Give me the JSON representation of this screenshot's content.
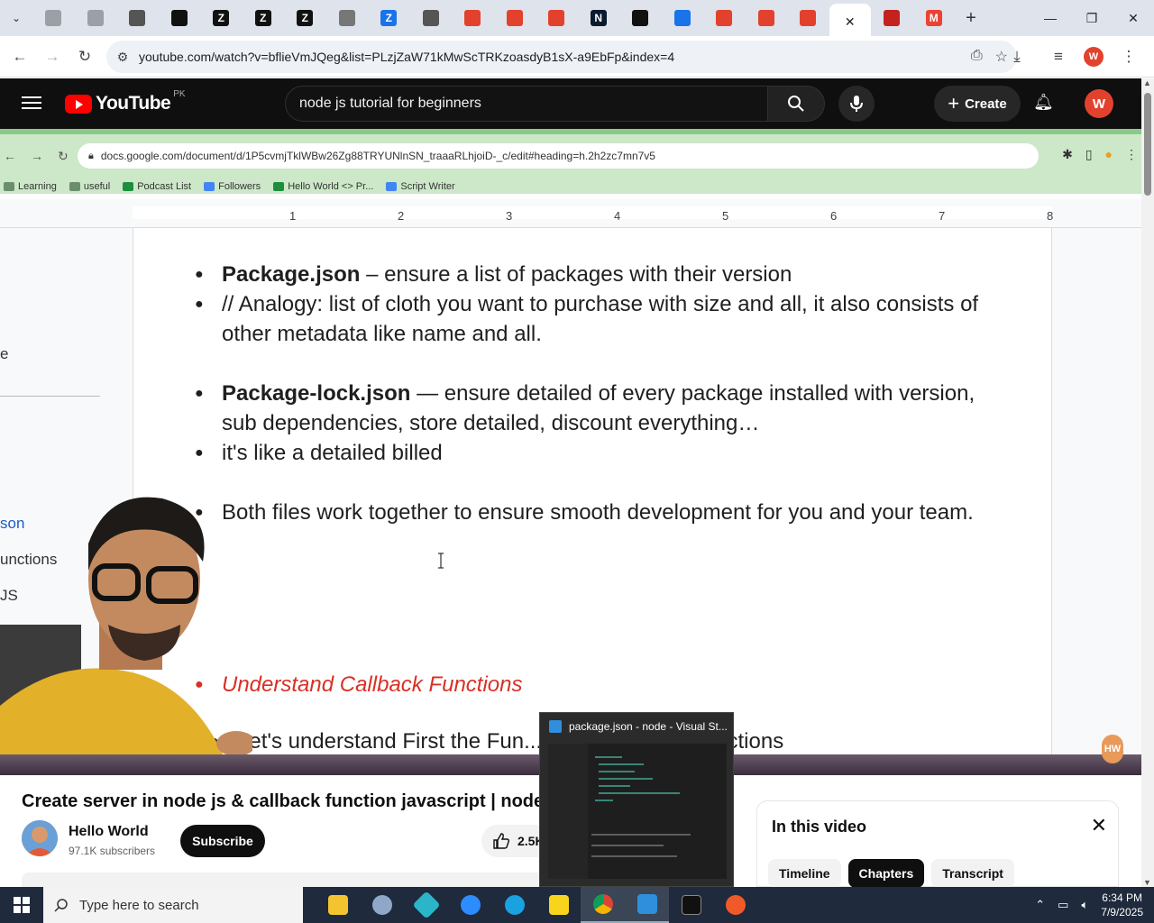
{
  "browser": {
    "tabs": [
      {
        "name": "tab-1",
        "glyph": "",
        "color": "#9aa0a6"
      },
      {
        "name": "tab-2",
        "glyph": "",
        "color": "#9aa0a6"
      },
      {
        "name": "tab-3",
        "glyph": "",
        "color": "#555555"
      },
      {
        "name": "tab-4",
        "glyph": "",
        "color": "#111111"
      },
      {
        "name": "tab-5",
        "glyph": "Z",
        "color": "#111111"
      },
      {
        "name": "tab-6",
        "glyph": "Z",
        "color": "#111111"
      },
      {
        "name": "tab-7",
        "glyph": "Z",
        "color": "#111111"
      },
      {
        "name": "tab-8",
        "glyph": "",
        "color": "#777777"
      },
      {
        "name": "tab-9",
        "glyph": "Z",
        "color": "#1a73e8"
      },
      {
        "name": "tab-10",
        "glyph": "",
        "color": "#555555"
      },
      {
        "name": "tab-11",
        "glyph": "",
        "color": "#e2422d"
      },
      {
        "name": "tab-12",
        "glyph": "",
        "color": "#e2422d"
      },
      {
        "name": "tab-13",
        "glyph": "",
        "color": "#e2422d"
      },
      {
        "name": "tab-14",
        "glyph": "N",
        "color": "#0b1a2e"
      },
      {
        "name": "tab-15",
        "glyph": "",
        "color": "#111111"
      },
      {
        "name": "tab-16",
        "glyph": "",
        "color": "#1a73e8"
      },
      {
        "name": "tab-17",
        "glyph": "",
        "color": "#e2422d"
      },
      {
        "name": "tab-18",
        "glyph": "",
        "color": "#e2422d"
      },
      {
        "name": "tab-19",
        "glyph": "",
        "color": "#e2422d"
      },
      {
        "name": "tab-20-active",
        "glyph": "✕",
        "color": "#ffffff"
      },
      {
        "name": "tab-21",
        "glyph": "",
        "color": "#c5221f"
      },
      {
        "name": "tab-22",
        "glyph": "M",
        "color": "#ea4335"
      }
    ],
    "url": "youtube.com/watch?v=bflieVmJQeg&list=PLzjZaW71kMwScTRKzoasdyB1sX-a9EbFp&index=4"
  },
  "youtube": {
    "region": "PK",
    "logo_word": "YouTube",
    "search_query": "node js tutorial for beginners",
    "create_label": "Create",
    "avatar_letter": "W"
  },
  "recorded": {
    "url": "docs.google.com/document/d/1P5cvmjTklWBw26Zg88TRYUNlnSN_traaaRLhjoiD-_c/edit#heading=h.2h2zc7mn7v5",
    "bookmarks": [
      "Learning",
      "useful",
      "Podcast List",
      "Followers",
      "Hello World <> Pr...",
      "Script Writer"
    ],
    "ruler_numbers": [
      "1",
      "2",
      "3",
      "4",
      "5",
      "6",
      "7",
      "8"
    ],
    "outline": [
      "e",
      "son",
      "unctions",
      "JS"
    ],
    "bullets": {
      "b1_bold": "Package.json",
      "b1_rest": " – ensure a list of packages with their version",
      "b2": "// Analogy: list of cloth you want to purchase with size and all, it also consists of other metadata like name and all.",
      "b3_bold": "Package-lock.json",
      "b3_rest": " — ensure detailed of every package installed with version, sub dependencies, store detailed, discount everything…",
      "b4": "it's like a detailed billed",
      "b5": "Both files work together to ensure smooth development for you and your team.",
      "heading": "Understand Callback Functions",
      "b7": "Let's understand First the Fun... ways to write a functions"
    },
    "badge": "HW"
  },
  "video": {
    "title": "Create server in node js & callback function javascript | node js t",
    "channel": "Hello World",
    "subscribers": "97.1K subscribers",
    "subscribe_label": "Subscribe",
    "likes": "2.5K"
  },
  "panel": {
    "title": "In this video",
    "chips": [
      "Timeline",
      "Chapters",
      "Transcript"
    ]
  },
  "preview": {
    "title": "package.json - node - Visual St..."
  },
  "taskbar": {
    "search_placeholder": "Type here to search",
    "time": "6:34 PM",
    "date": "7/9/2025"
  }
}
